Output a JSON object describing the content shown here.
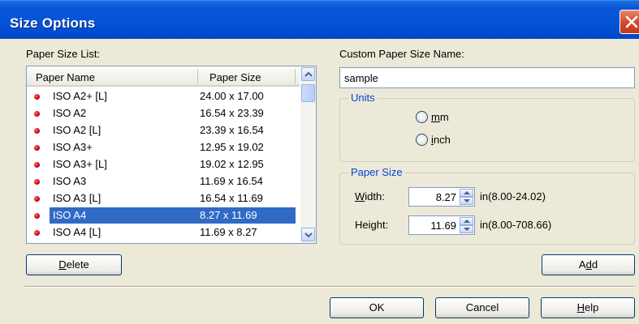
{
  "window": {
    "title": "Size Options"
  },
  "paper_list": {
    "label": "Paper Size List:",
    "columns": [
      "Paper Name",
      "Paper Size"
    ],
    "rows": [
      {
        "name": "ISO A2+ [L]",
        "size": "24.00 x 17.00"
      },
      {
        "name": "ISO A2",
        "size": "16.54 x 23.39"
      },
      {
        "name": "ISO A2 [L]",
        "size": "23.39 x 16.54"
      },
      {
        "name": "ISO A3+",
        "size": "12.95 x 19.02"
      },
      {
        "name": "ISO A3+ [L]",
        "size": "19.02 x 12.95"
      },
      {
        "name": "ISO A3",
        "size": "11.69 x 16.54"
      },
      {
        "name": "ISO A3 [L]",
        "size": "16.54 x 11.69"
      },
      {
        "name": "ISO A4",
        "size": "8.27 x 11.69",
        "selected": true
      },
      {
        "name": "ISO A4 [L]",
        "size": "11.69 x 8.27"
      }
    ],
    "delete_label": "Delete"
  },
  "custom_name": {
    "label": "Custom Paper Size Name:",
    "value": "sample"
  },
  "units": {
    "title": "Units",
    "options": [
      "mm",
      "inch"
    ]
  },
  "paper_size": {
    "title": "Paper Size",
    "width": {
      "label": "Width:",
      "value": "8.27",
      "range": "in(8.00-24.02)"
    },
    "height": {
      "label": "Height:",
      "value": "11.69",
      "range": "in(8.00-708.66)"
    }
  },
  "buttons": {
    "add": "Add",
    "ok": "OK",
    "cancel": "Cancel",
    "help": "Help"
  },
  "colors": {
    "title_bar": "#0453d6",
    "selection": "#316ac5",
    "group_title": "#0046d5"
  }
}
